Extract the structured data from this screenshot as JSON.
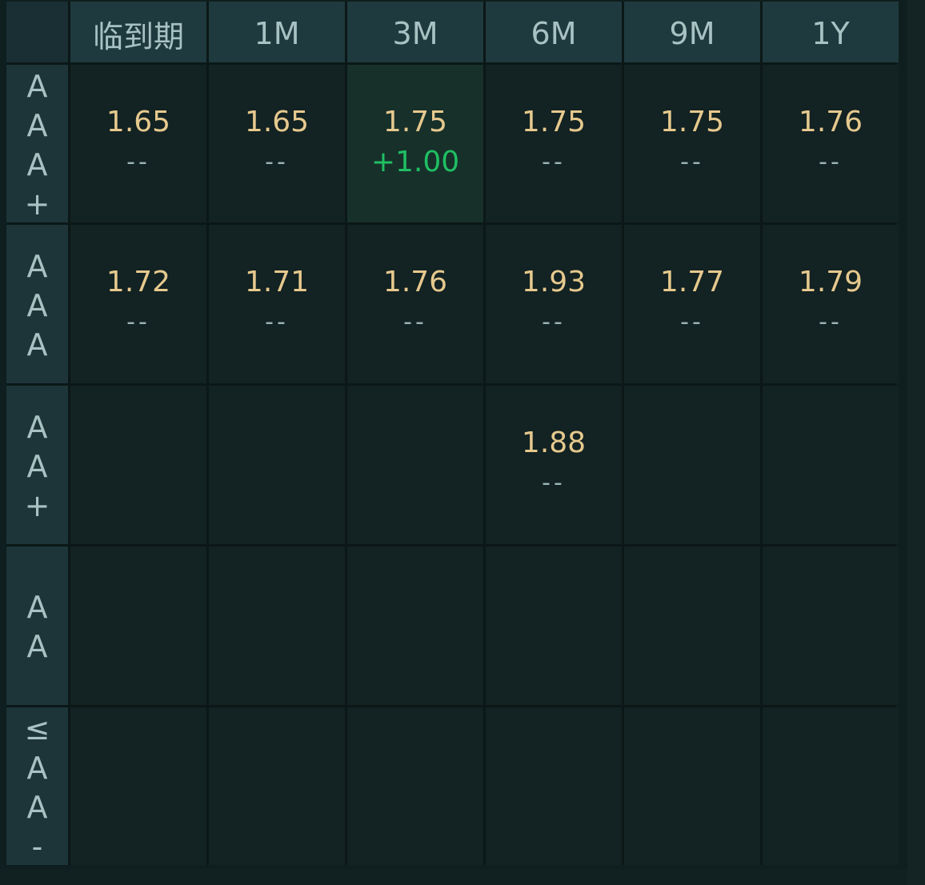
{
  "columns": [
    "临到期",
    "1M",
    "3M",
    "6M",
    "9M",
    "1Y"
  ],
  "rows": [
    {
      "rating": "AAA+",
      "cells": [
        {
          "rate": "1.65",
          "change": "--"
        },
        {
          "rate": "1.65",
          "change": "--"
        },
        {
          "rate": "1.75",
          "change": "+1.00"
        },
        {
          "rate": "1.75",
          "change": "--"
        },
        {
          "rate": "1.75",
          "change": "--"
        },
        {
          "rate": "1.76",
          "change": "--"
        }
      ]
    },
    {
      "rating": "AAA",
      "cells": [
        {
          "rate": "1.72",
          "change": "--"
        },
        {
          "rate": "1.71",
          "change": "--"
        },
        {
          "rate": "1.76",
          "change": "--"
        },
        {
          "rate": "1.93",
          "change": "--"
        },
        {
          "rate": "1.77",
          "change": "--"
        },
        {
          "rate": "1.79",
          "change": "--"
        }
      ]
    },
    {
      "rating": "AA+",
      "cells": [
        {
          "rate": "",
          "change": ""
        },
        {
          "rate": "",
          "change": ""
        },
        {
          "rate": "",
          "change": ""
        },
        {
          "rate": "1.88",
          "change": "--"
        },
        {
          "rate": "",
          "change": ""
        },
        {
          "rate": "",
          "change": ""
        }
      ]
    },
    {
      "rating": "AA",
      "cells": [
        {
          "rate": "",
          "change": ""
        },
        {
          "rate": "",
          "change": ""
        },
        {
          "rate": "",
          "change": ""
        },
        {
          "rate": "",
          "change": ""
        },
        {
          "rate": "",
          "change": ""
        },
        {
          "rate": "",
          "change": ""
        }
      ]
    },
    {
      "rating": "≤AA-",
      "cells": [
        {
          "rate": "",
          "change": ""
        },
        {
          "rate": "",
          "change": ""
        },
        {
          "rate": "",
          "change": ""
        },
        {
          "rate": "",
          "change": ""
        },
        {
          "rate": "",
          "change": ""
        },
        {
          "rate": "",
          "change": ""
        }
      ]
    }
  ],
  "colors": {
    "rate": "#e6c98e",
    "change_neutral": "#9ab4b6",
    "change_up": "#1fbf63",
    "header_bg": "#1f3a3e",
    "cell_bg": "#132222",
    "highlight_bg": "#17302a"
  }
}
